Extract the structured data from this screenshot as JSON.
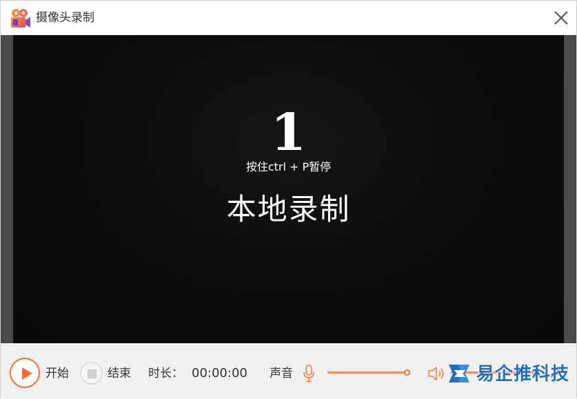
{
  "window": {
    "title": "摄像头录制",
    "app_icon": "video-camera-app-icon",
    "close_icon": "close-icon"
  },
  "preview": {
    "countdown": "1",
    "hint": "按住ctrl + P暂停",
    "mode_label": "本地录制"
  },
  "toolbar": {
    "start_label": "开始",
    "stop_label": "结束",
    "duration_label": "时长：",
    "duration_value": "00:00:00",
    "sound_label": "声音",
    "mic_level": 0.92,
    "speaker_level": 0.85
  },
  "watermark": {
    "text": "易企推科技"
  },
  "colors": {
    "accent": "#ff6a2c",
    "video_bg": "#0d0d0d",
    "side_bar": "#4a4a4a",
    "toolbar_bg": "#f1f1f1",
    "watermark": "#1f6fc4"
  }
}
